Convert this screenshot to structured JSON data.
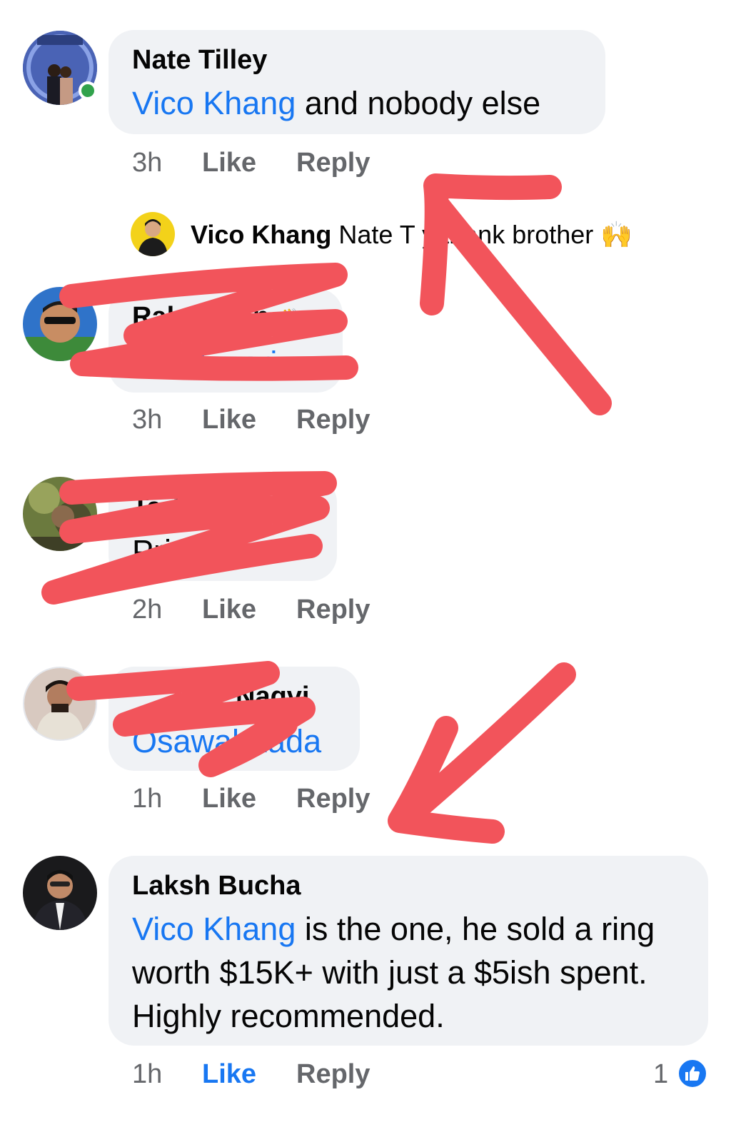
{
  "comments": [
    {
      "author": "Nate Tilley",
      "mention": "Vico Khang",
      "text": " and nobody else",
      "time": "3h",
      "like_label": "Like",
      "reply_label": "Reply",
      "online": true
    },
    {
      "author": "Rahul Jain",
      "author_emoji": "👋",
      "mention": "Tiwari",
      "time": "3h",
      "like_label": "Like",
      "reply_label": "Reply",
      "redacted": true
    },
    {
      "author": "Tarik",
      "text": "Privat",
      "time": "2h",
      "like_label": "Like",
      "reply_label": "Reply",
      "redacted": true
    },
    {
      "author": "Naqvi",
      "mention": "Osawal Zada",
      "time": "1h",
      "like_label": "Like",
      "reply_label": "Reply",
      "redacted": true
    },
    {
      "author": "Laksh Bucha",
      "mention": "Vico Khang",
      "text": " is the one, he sold a ring worth $15K+ with just a $5ish spent. Highly recommended.",
      "time": "1h",
      "like_label": "Like",
      "like_active": true,
      "reply_label": "Reply",
      "reaction_count": "1",
      "reaction_icon": "thumbs-up-icon"
    }
  ],
  "reply_preview": {
    "author": "Vico Khang",
    "text": "Nate T    y thank brother",
    "emoji": "🙌"
  },
  "colors": {
    "mention": "#1877f2",
    "bubble": "#f0f2f5",
    "meta": "#65676b",
    "annotation": "#f2545b",
    "online": "#31a24c"
  }
}
